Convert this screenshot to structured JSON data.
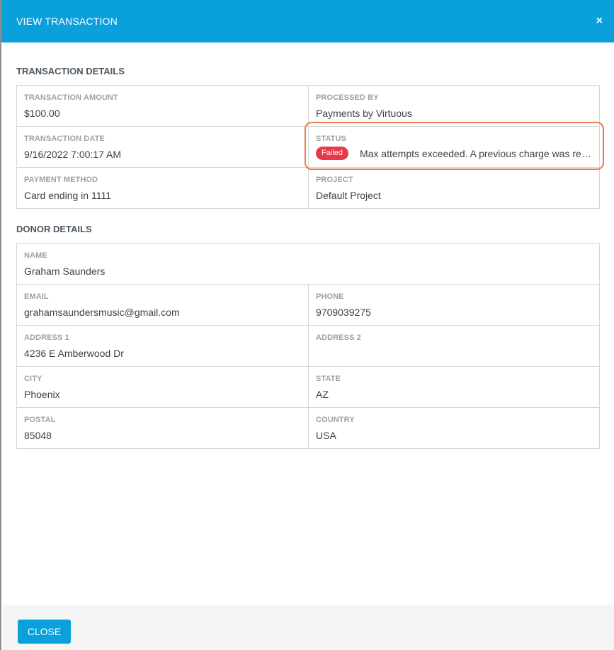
{
  "header": {
    "title": "VIEW TRANSACTION",
    "close_icon": "×"
  },
  "transaction": {
    "section_title": "TRANSACTION DETAILS",
    "amount": {
      "label": "TRANSACTION AMOUNT",
      "value": "$100.00"
    },
    "processed_by": {
      "label": "PROCESSED BY",
      "value": "Payments by Virtuous"
    },
    "date": {
      "label": "TRANSACTION DATE",
      "value": "9/16/2022 7:00:17 AM"
    },
    "status": {
      "label": "STATUS",
      "badge": "Failed",
      "message": "Max attempts exceeded. A previous charge was received for this transaction.",
      "badge_color": "#e8394a"
    },
    "payment_method": {
      "label": "PAYMENT METHOD",
      "value": "Card ending in 1111"
    },
    "project": {
      "label": "PROJECT",
      "value": "Default Project"
    }
  },
  "donor": {
    "section_title": "DONOR DETAILS",
    "name": {
      "label": "NAME",
      "value": "Graham Saunders"
    },
    "email": {
      "label": "EMAIL",
      "value": "grahamsaundersmusic@gmail.com"
    },
    "phone": {
      "label": "PHONE",
      "value": "9709039275"
    },
    "address1": {
      "label": "ADDRESS 1",
      "value": "4236 E Amberwood Dr"
    },
    "address2": {
      "label": "ADDRESS 2",
      "value": ""
    },
    "city": {
      "label": "CITY",
      "value": "Phoenix"
    },
    "state": {
      "label": "STATE",
      "value": "AZ"
    },
    "postal": {
      "label": "POSTAL",
      "value": "85048"
    },
    "country": {
      "label": "COUNTRY",
      "value": "USA"
    }
  },
  "footer": {
    "close_label": "CLOSE"
  },
  "colors": {
    "header_bg": "#0aa0dc",
    "highlight": "#f07a4f"
  }
}
